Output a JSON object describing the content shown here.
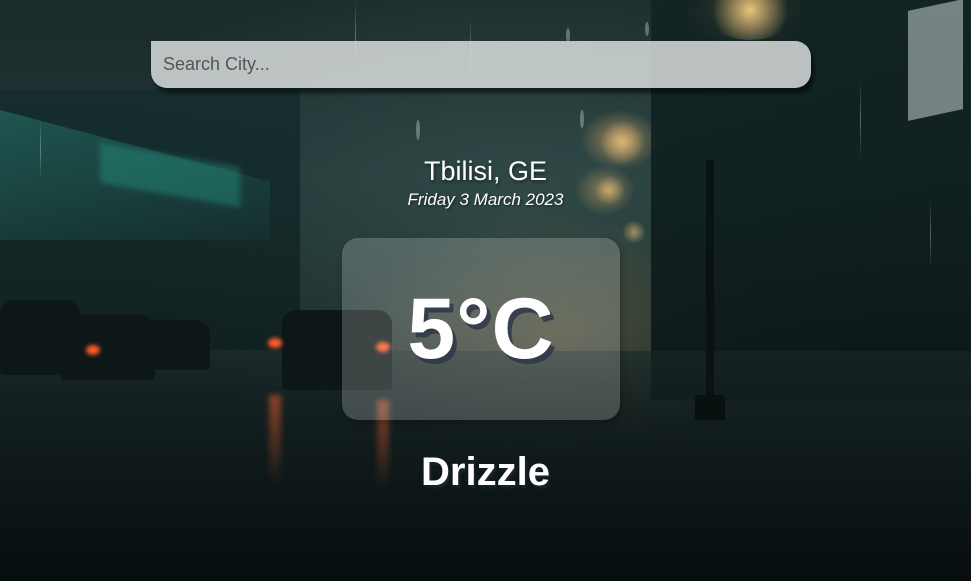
{
  "search": {
    "placeholder": "Search City...",
    "value": ""
  },
  "location": {
    "city": "Tbilisi, GE",
    "date": "Friday 3 March 2023"
  },
  "weather": {
    "temperature": "5°C",
    "condition": "Drizzle"
  },
  "colors": {
    "text": "#ffffff",
    "search_bg": "#e1e4e4",
    "panel_bg": "rgba(255,255,255,0.2)"
  }
}
